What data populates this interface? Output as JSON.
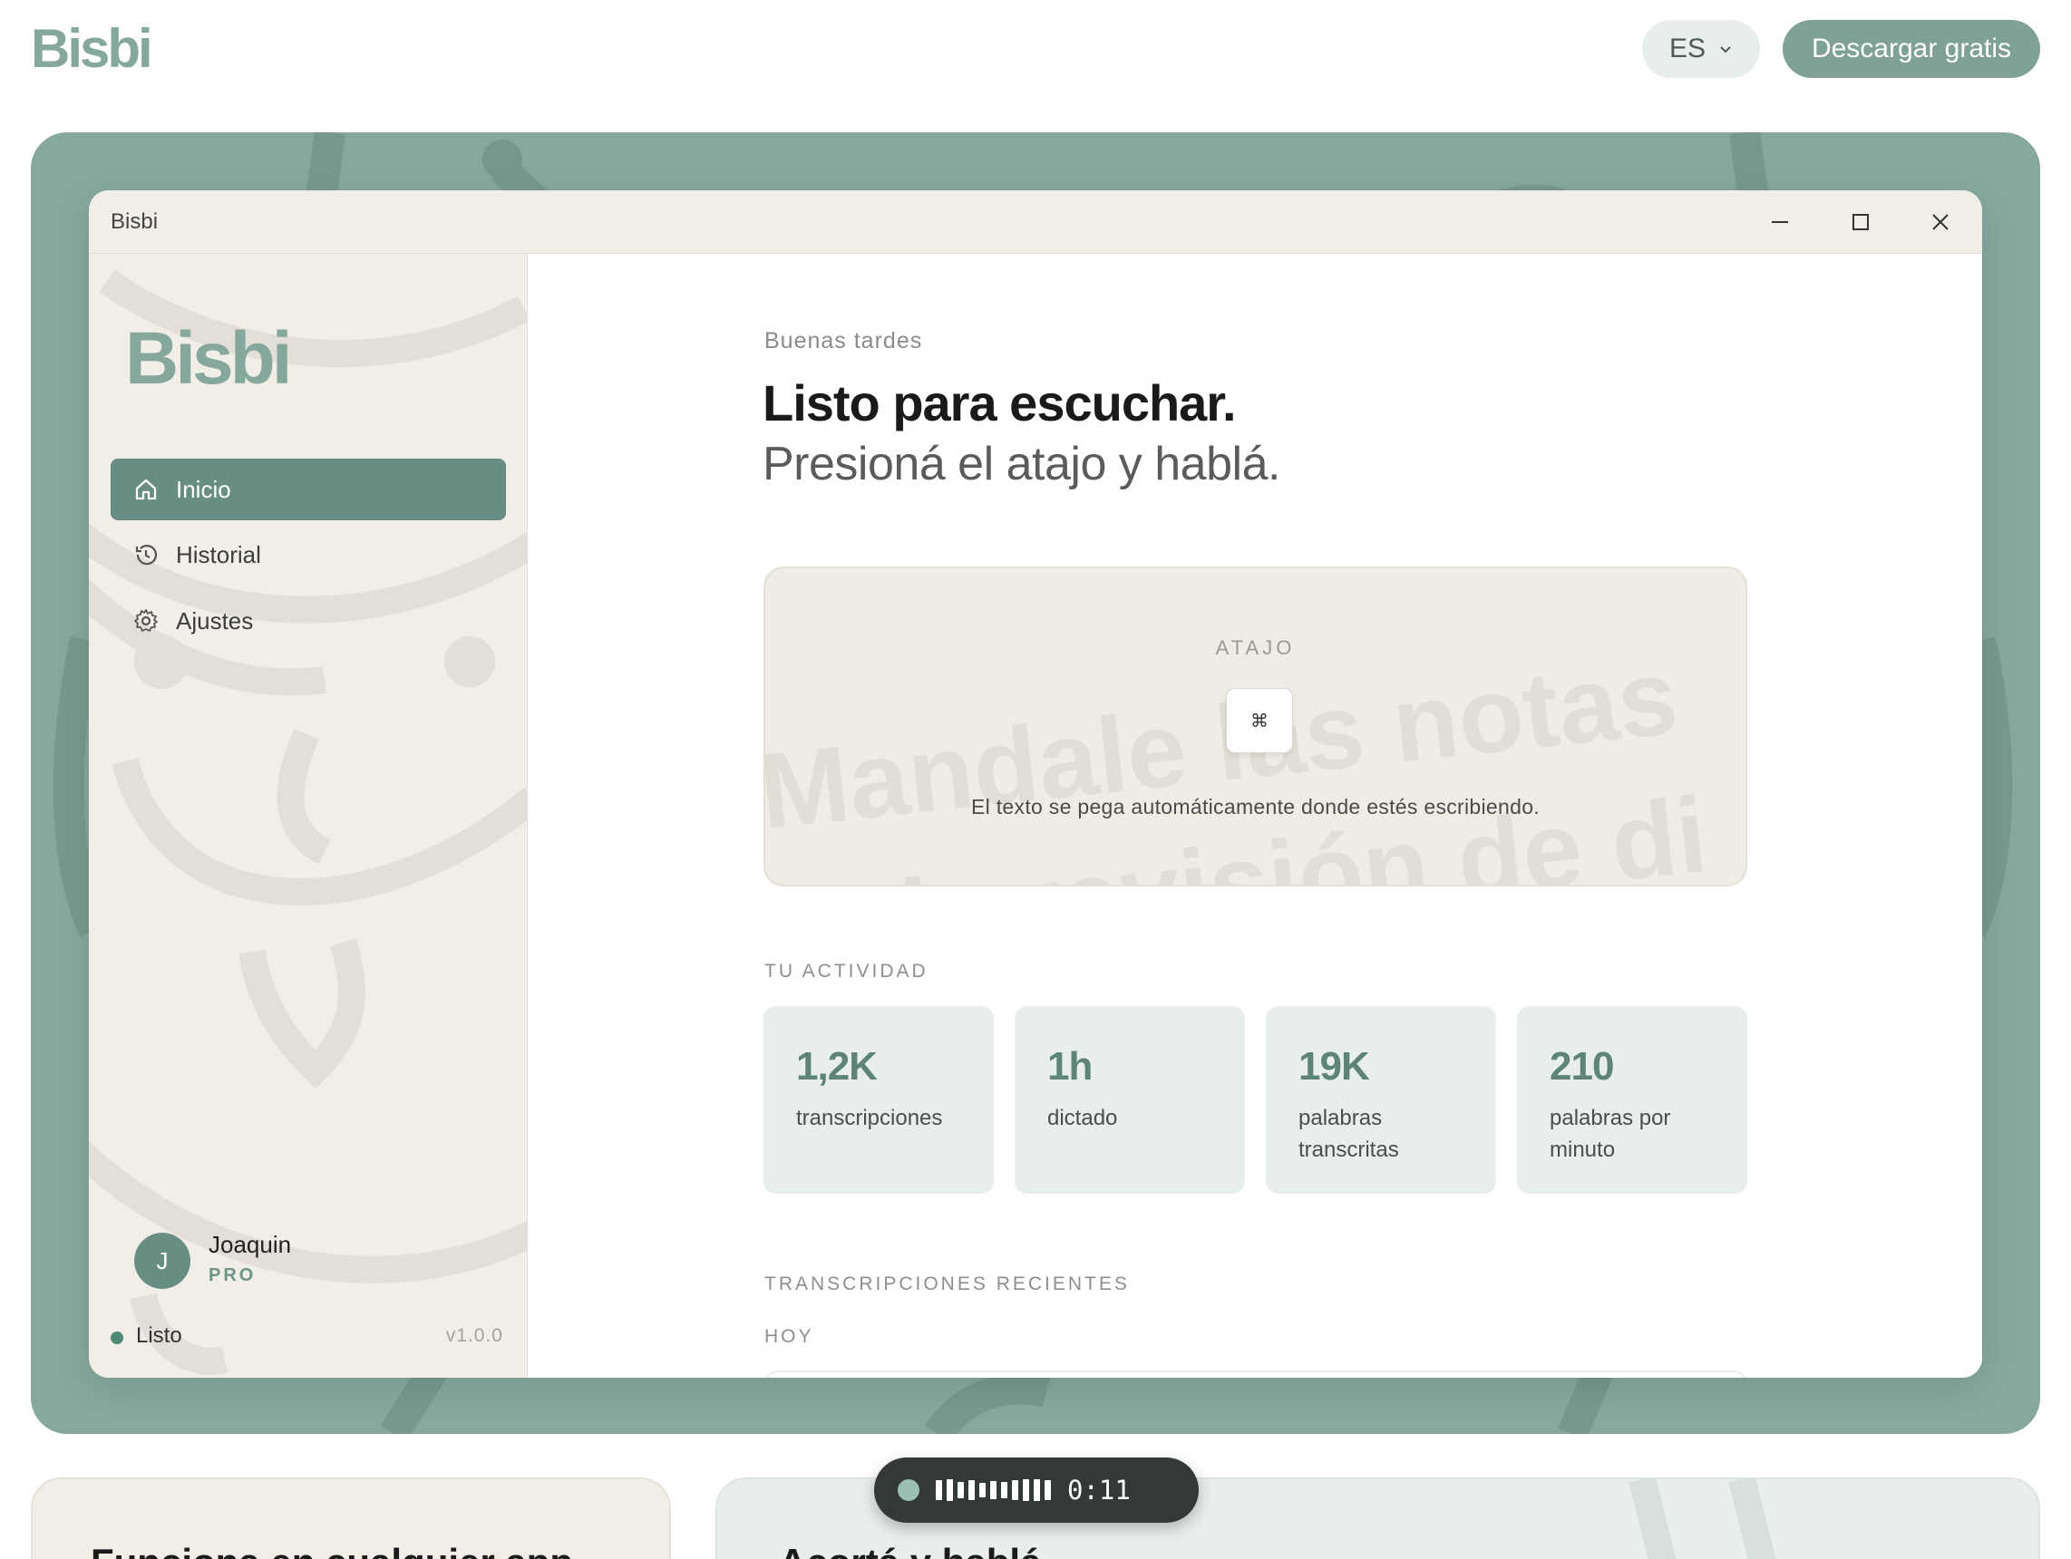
{
  "site": {
    "logo": "Bisbi",
    "language": "ES",
    "download_label": "Descargar gratis"
  },
  "app": {
    "window_title": "Bisbi",
    "sidebar": {
      "logo": "Bisbi",
      "items": [
        {
          "label": "Inicio",
          "icon": "home-icon",
          "active": true
        },
        {
          "label": "Historial",
          "icon": "history-icon",
          "active": false
        },
        {
          "label": "Ajustes",
          "icon": "gear-icon",
          "active": false
        }
      ],
      "user": {
        "initial": "J",
        "name": "Joaquin",
        "plan": "PRO"
      },
      "status": "Listo",
      "version": "v1.0.0"
    },
    "main": {
      "greeting": "Buenas tardes",
      "headline": "Listo para escuchar.",
      "subheadline": "Presioná el atajo y hablá.",
      "shortcut": {
        "label": "ATAJO",
        "key": "⌘",
        "description": "El texto se pega automáticamente donde estés escribiendo.",
        "background_text_line1": "Mandale las notas",
        "background_text_line2": "de la revisión de di"
      },
      "activity_label": "TU ACTIVIDAD",
      "stats": [
        {
          "value": "1,2K",
          "label": "transcripciones"
        },
        {
          "value": "1h",
          "label": "dictado"
        },
        {
          "value": "19K",
          "label": "palabras transcritas"
        },
        {
          "value": "210",
          "label": "palabras por minuto"
        }
      ],
      "recent_label": "TRANSCRIPCIONES RECIENTES",
      "today_label": "HOY"
    }
  },
  "recorder": {
    "time": "0:11"
  },
  "features": {
    "left_title": "Funciona en cualquier app",
    "right_title": "Acortá y hablá"
  },
  "colors": {
    "accent": "#688e83",
    "hero_bg": "#86a89d",
    "sidebar_bg": "#f1eee8",
    "stat_bg": "#e8eeeb"
  }
}
